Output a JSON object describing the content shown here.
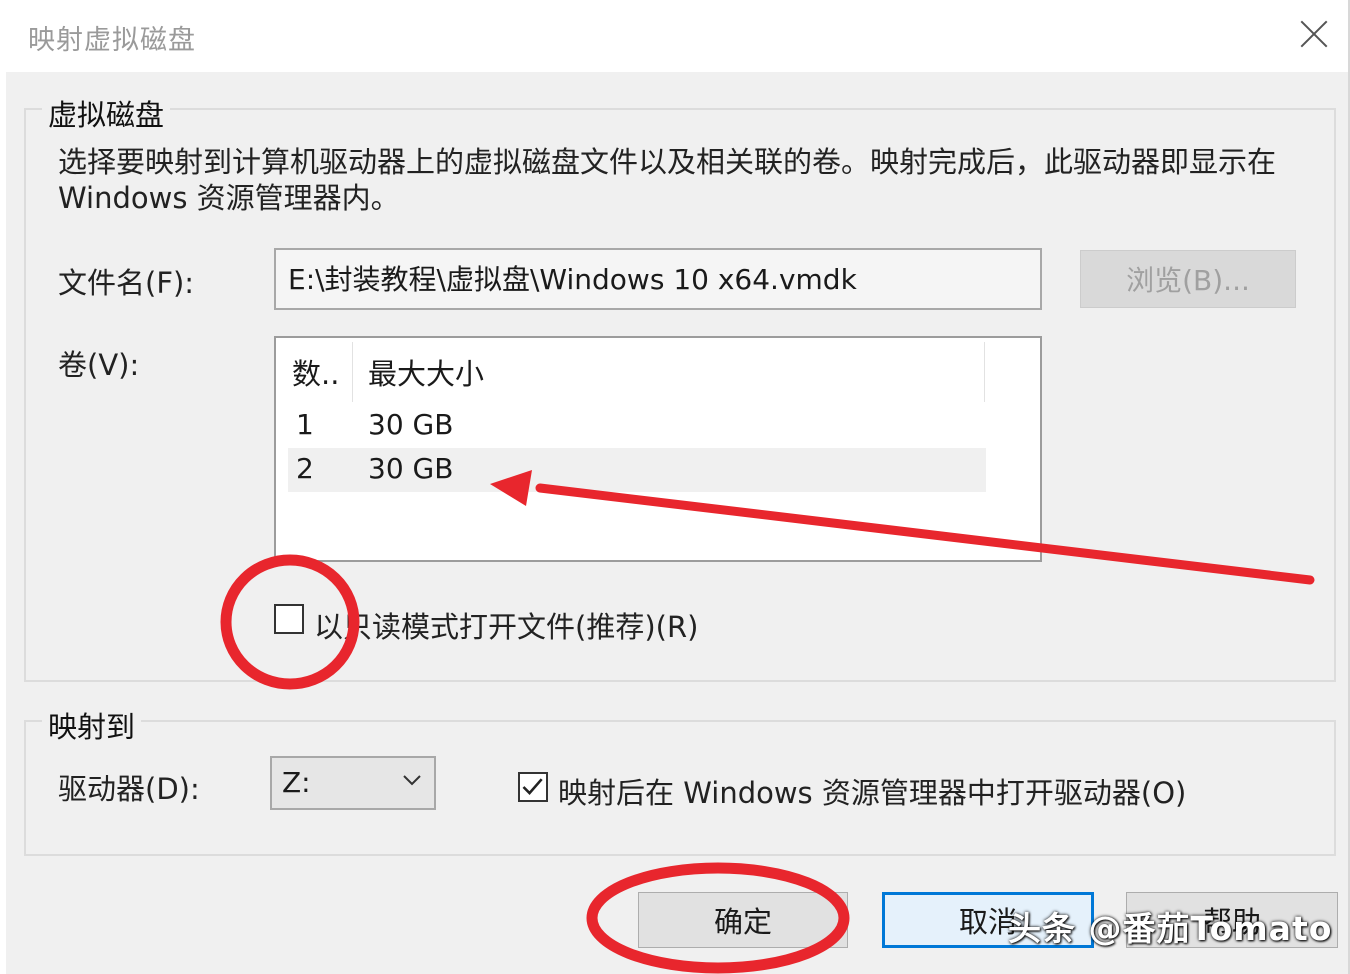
{
  "window": {
    "title": "映射虚拟磁盘"
  },
  "virtual_disk": {
    "legend": "虚拟磁盘",
    "description": "选择要映射到计算机驱动器上的虚拟磁盘文件以及相关联的卷。映射完成后，此驱动器即显示在 Windows 资源管理器内。",
    "file_label": "文件名(F):",
    "file_value": "E:\\封装教程\\虚拟盘\\Windows 10 x64.vmdk",
    "browse_label": "浏览(B)...",
    "volume_label": "卷(V):",
    "columns": [
      "数..",
      "最大大小"
    ],
    "rows": [
      {
        "number": "1",
        "size": "30 GB"
      },
      {
        "number": "2",
        "size": "30 GB"
      }
    ],
    "readonly_label": "以只读模式打开文件(推荐)(R)",
    "readonly_checked": false
  },
  "map_to": {
    "legend": "映射到",
    "drive_label": "驱动器(D):",
    "drive_value": "Z:",
    "open_explorer_label": "映射后在 Windows 资源管理器中打开驱动器(O)",
    "open_explorer_checked": true
  },
  "buttons": {
    "ok": "确定",
    "cancel": "取消",
    "help": "帮助"
  },
  "watermark": "头条 @番茄Tomato",
  "annotation_color": "#e8262d"
}
